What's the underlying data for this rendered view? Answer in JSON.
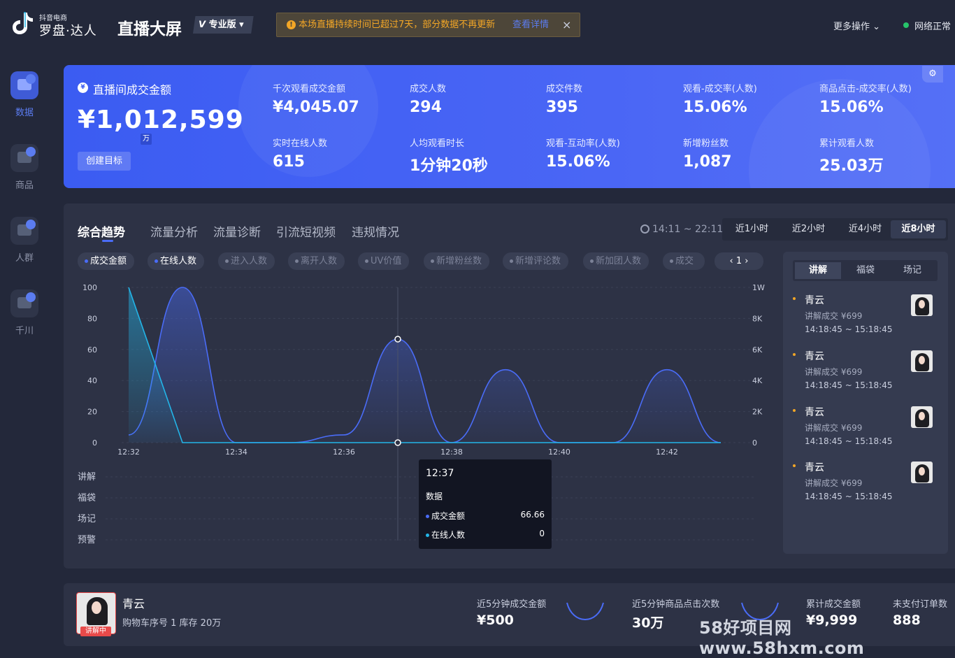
{
  "brand": {
    "small": "抖音电商",
    "big": "罗盘·达人"
  },
  "header": {
    "title": "直播大屏",
    "edition": "专业版",
    "notice_text": "本场直播持续时间已超过7天，部分数据不再更新",
    "notice_link": "查看详情",
    "notice_close": "×",
    "more_ops": "更多操作 ⌄",
    "net_status": "网络正常"
  },
  "sidebar": {
    "items": [
      {
        "label": "数据",
        "icon": "data-trend-icon"
      },
      {
        "label": "商品",
        "icon": "cart-icon"
      },
      {
        "label": "人群",
        "icon": "people-icon"
      },
      {
        "label": "千川",
        "icon": "qianchuan-icon"
      }
    ]
  },
  "hero": {
    "label": "直播间成交金额",
    "value": "¥1,012,599",
    "unit": "万",
    "button": "创建目标",
    "settings_icon": "⚙",
    "metrics": [
      {
        "label": "千次观看成交金额",
        "value": "¥4,045.07"
      },
      {
        "label": "成交人数",
        "value": "294"
      },
      {
        "label": "成交件数",
        "value": "395"
      },
      {
        "label": "观看-成交率(人数)",
        "value": "15.06%"
      },
      {
        "label": "商品点击-成交率(人数)",
        "value": "15.06%"
      },
      {
        "label": "实时在线人数",
        "value": "615"
      },
      {
        "label": "人均观看时长",
        "value": "1分钟20秒"
      },
      {
        "label": "观看-互动率(人数)",
        "value": "15.06%"
      },
      {
        "label": "新增粉丝数",
        "value": "1,087"
      },
      {
        "label": "累计观看人数",
        "value": "25.03万"
      }
    ]
  },
  "trend": {
    "tabs": [
      "综合趋势",
      "流量分析",
      "流量诊断",
      "引流短视频",
      "违规情况"
    ],
    "time_range": "14:11 ~ 22:11",
    "ranges": [
      "近1小时",
      "近2小时",
      "近4小时",
      "近8小时"
    ],
    "active_range": 3,
    "chips": [
      {
        "label": "成交金额",
        "active": true
      },
      {
        "label": "在线人数",
        "active": true
      },
      {
        "label": "进入人数",
        "active": false
      },
      {
        "label": "离开人数",
        "active": false
      },
      {
        "label": "UV价值",
        "active": false
      },
      {
        "label": "新增粉丝数",
        "active": false
      },
      {
        "label": "新增评论数",
        "active": false
      },
      {
        "label": "新加团人数",
        "active": false
      },
      {
        "label": "成交",
        "active": false
      }
    ],
    "pager": "‹  1  ›",
    "event_rows": [
      "讲解",
      "福袋",
      "场记",
      "预警"
    ]
  },
  "chart_data": {
    "type": "area",
    "x": [
      "12:32",
      "12:33",
      "12:34",
      "12:35",
      "12:36",
      "12:37",
      "12:38",
      "12:39",
      "12:40",
      "12:41",
      "12:42",
      "12:43"
    ],
    "x_ticks": [
      "12:32",
      "12:34",
      "12:36",
      "12:38",
      "12:40",
      "12:42"
    ],
    "y_left_ticks": [
      "0",
      "20",
      "40",
      "60",
      "80",
      "100"
    ],
    "y_right_ticks": [
      "0",
      "2K",
      "4K",
      "6K",
      "8K",
      "1W"
    ],
    "ylim": [
      0,
      100
    ],
    "series": [
      {
        "name": "成交金额",
        "color": "#4a6cf7",
        "values": [
          5,
          100,
          0,
          0,
          5,
          66.66,
          0,
          47,
          0,
          0,
          47,
          0
        ]
      },
      {
        "name": "在线人数",
        "color": "#23b5e8",
        "values": [
          100,
          0,
          0,
          0,
          0,
          0,
          0,
          0,
          0,
          0,
          0,
          0
        ]
      }
    ],
    "tooltip": {
      "title": "12:37",
      "subtitle": "数据",
      "rows": [
        {
          "name": "成交金额",
          "value": "66.66",
          "color": "#4a6cf7"
        },
        {
          "name": "在线人数",
          "value": "0",
          "color": "#23b5e8"
        }
      ]
    }
  },
  "log": {
    "tabs": [
      "讲解",
      "福袋",
      "场记"
    ],
    "items": [
      {
        "name": "青云",
        "desc": "讲解成交 ¥699",
        "time": "14:18:45 ~ 15:18:45"
      },
      {
        "name": "青云",
        "desc": "讲解成交 ¥699",
        "time": "14:18:45 ~ 15:18:45"
      },
      {
        "name": "青云",
        "desc": "讲解成交 ¥699",
        "time": "14:18:45 ~ 15:18:45"
      },
      {
        "name": "青云",
        "desc": "讲解成交 ¥699",
        "time": "14:18:45 ~ 15:18:45"
      }
    ]
  },
  "bottom": {
    "product_name": "青云",
    "product_info": "购物车序号 1    库存 20万",
    "tag": "讲解中",
    "stats": [
      {
        "label": "近5分钟成交金额",
        "value": "¥500"
      },
      {
        "label": "近5分钟商品点击次数",
        "value": "30万"
      },
      {
        "label": "累计成交金额",
        "value": "¥9,999"
      },
      {
        "label": "未支付订单数",
        "value": "888"
      }
    ]
  },
  "watermark": "58好项目网www.58hxm.com"
}
